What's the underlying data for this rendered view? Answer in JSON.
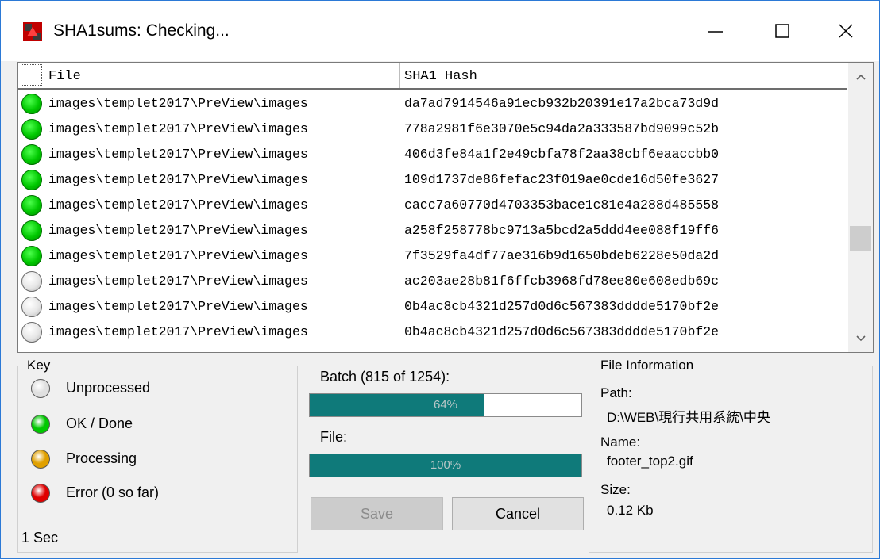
{
  "window": {
    "title": "SHA1sums: Checking...",
    "buttons": {
      "minimize": "minimize",
      "maximize": "maximize",
      "close": "close"
    }
  },
  "list": {
    "columns": {
      "file": "File",
      "hash": "SHA1 Hash"
    },
    "rows": [
      {
        "status": "ok",
        "file": "images\\templet2017\\PreView\\images",
        "hash": "da7ad7914546a91ecb932b20391e17a2bca73d9d"
      },
      {
        "status": "ok",
        "file": "images\\templet2017\\PreView\\images",
        "hash": "778a2981f6e3070e5c94da2a333587bd9099c52b"
      },
      {
        "status": "ok",
        "file": "images\\templet2017\\PreView\\images",
        "hash": "406d3fe84a1f2e49cbfa78f2aa38cbf6eaaccbb0"
      },
      {
        "status": "ok",
        "file": "images\\templet2017\\PreView\\images",
        "hash": "109d1737de86fefac23f019ae0cde16d50fe3627"
      },
      {
        "status": "ok",
        "file": "images\\templet2017\\PreView\\images",
        "hash": "cacc7a60770d4703353bace1c81e4a288d485558"
      },
      {
        "status": "ok",
        "file": "images\\templet2017\\PreView\\images",
        "hash": "a258f258778bc9713a5bcd2a5ddd4ee088f19ff6"
      },
      {
        "status": "ok",
        "file": "images\\templet2017\\PreView\\images",
        "hash": "7f3529fa4df77ae316b9d1650bdeb6228e50da2d"
      },
      {
        "status": "unprocessed",
        "file": "images\\templet2017\\PreView\\images",
        "hash": "ac203ae28b81f6ffcb3968fd78ee80e608edb69c"
      },
      {
        "status": "unprocessed",
        "file": "images\\templet2017\\PreView\\images",
        "hash": "0b4ac8cb4321d257d0d6c567383dddde5170bf2e"
      },
      {
        "status": "unprocessed",
        "file": "images\\templet2017\\PreView\\images",
        "hash": "0b4ac8cb4321d257d0d6c567383dddde5170bf2e"
      }
    ]
  },
  "key": {
    "label": "Key",
    "items": [
      {
        "label": "Unprocessed",
        "color": "#e0e0e0",
        "icon": "circle-gray-icon"
      },
      {
        "label": "OK / Done",
        "color": "#00c800",
        "icon": "circle-green-icon"
      },
      {
        "label": "Processing",
        "color": "#e0a000",
        "icon": "circle-orange-icon"
      },
      {
        "label": "Error (0 so far)",
        "color": "#e00000",
        "icon": "circle-red-icon"
      }
    ],
    "elapsed": "1 Sec"
  },
  "progress": {
    "batch_label": "Batch (815 of 1254):",
    "batch_percent": 64,
    "batch_text": "64%",
    "file_label": "File:",
    "file_percent": 100,
    "file_text": "100%"
  },
  "actions": {
    "save": "Save",
    "cancel": "Cancel",
    "save_enabled": false
  },
  "file_info": {
    "label": "File Information",
    "path_label": "Path:",
    "path_value": "D:\\WEB\\現行共用系統\\中央",
    "name_label": "Name:",
    "name_value": "footer_top2.gif",
    "size_label": "Size:",
    "size_value": "0.12 Kb"
  },
  "colors": {
    "accent": "#0f7a7a",
    "window_border": "#2b79d6",
    "ok": "#00c800"
  }
}
